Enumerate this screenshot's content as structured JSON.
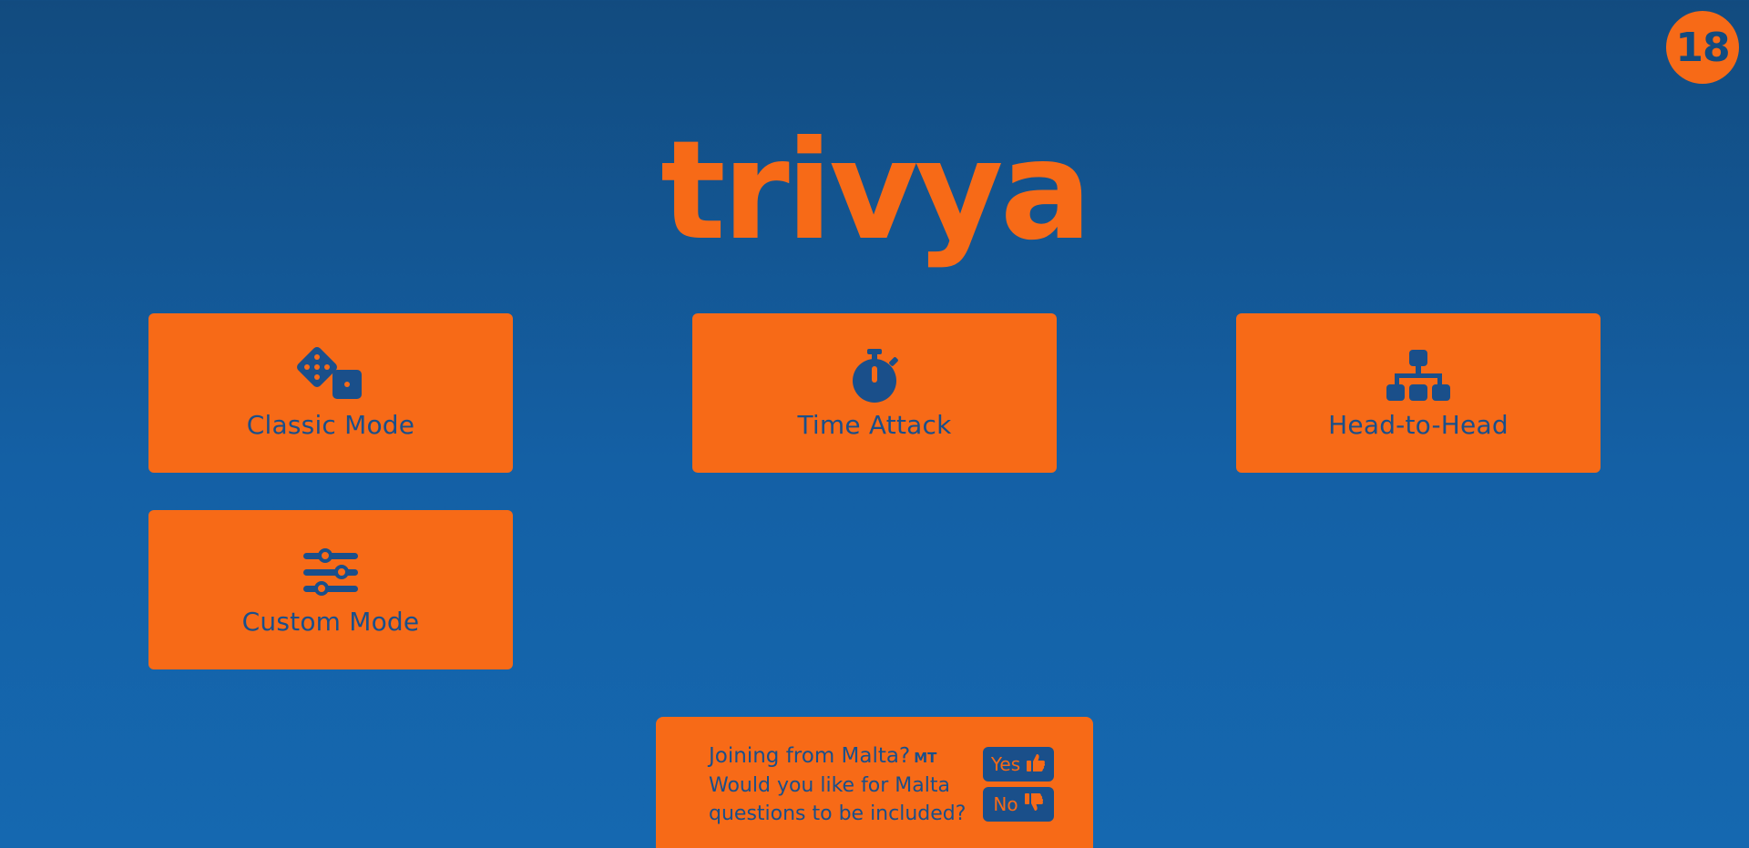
{
  "badge": {
    "value": "18"
  },
  "logo": {
    "text": "trivya"
  },
  "modes": [
    {
      "label": "Classic Mode",
      "icon": "dice-icon"
    },
    {
      "label": "Time Attack",
      "icon": "stopwatch-icon"
    },
    {
      "label": "Head-to-Head",
      "icon": "sitemap-icon"
    },
    {
      "label": "Custom Mode",
      "icon": "sliders-icon"
    }
  ],
  "malta_prompt": {
    "question": "Joining from Malta?",
    "country_code": "MT",
    "line2": "Would you like for Malta",
    "line3": "questions to be included?",
    "yes_label": "Yes",
    "no_label": "No",
    "yes_icon": "thumbs-up-icon",
    "no_icon": "thumbs-down-icon"
  },
  "colors": {
    "accent": "#f76a17",
    "dark_blue": "#1a4f8a",
    "background_top": "#124b7f",
    "background_bottom": "#1568b0"
  }
}
